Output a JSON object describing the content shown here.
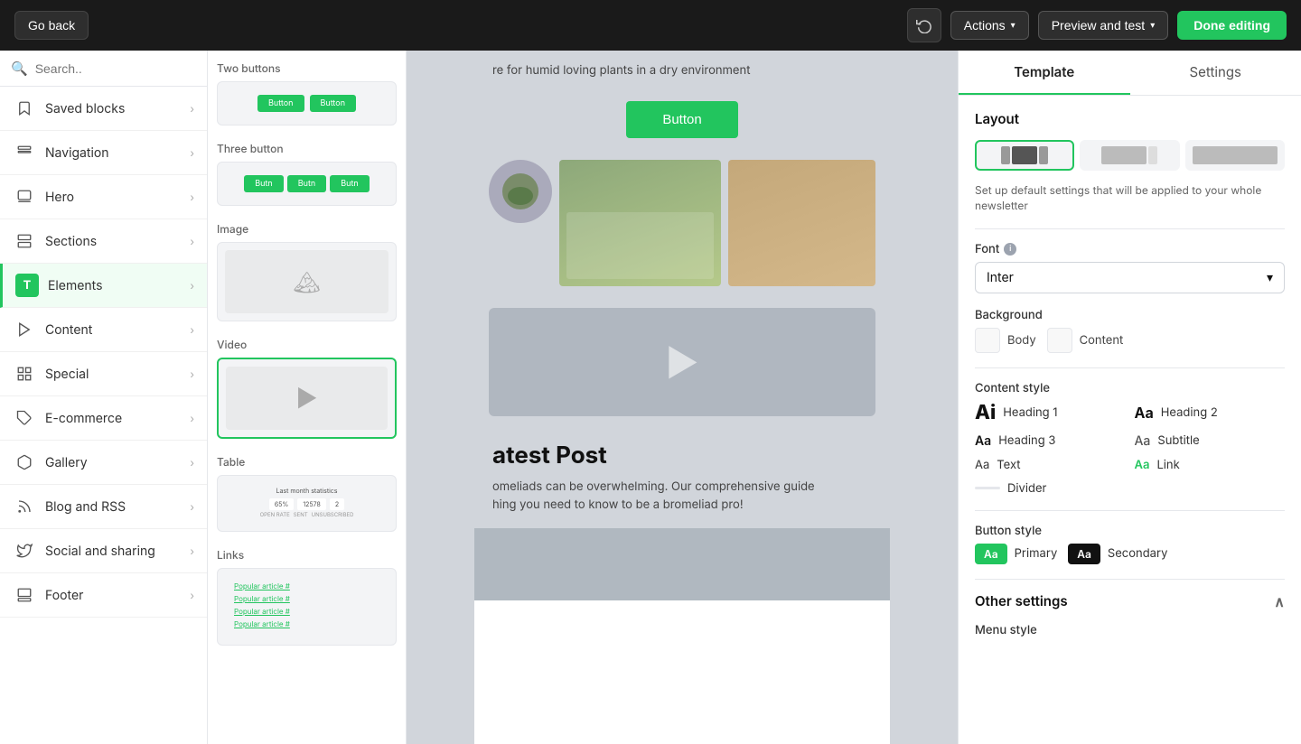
{
  "topbar": {
    "go_back_label": "Go back",
    "actions_label": "Actions",
    "preview_label": "Preview and test",
    "done_label": "Done editing"
  },
  "sidebar": {
    "search_placeholder": "Search..",
    "items": [
      {
        "id": "saved-blocks",
        "label": "Saved blocks",
        "icon": "bookmark"
      },
      {
        "id": "navigation",
        "label": "Navigation",
        "icon": "nav"
      },
      {
        "id": "hero",
        "label": "Hero",
        "icon": "hero"
      },
      {
        "id": "sections",
        "label": "Sections",
        "icon": "sections"
      },
      {
        "id": "elements",
        "label": "Elements",
        "icon": "elements",
        "active": true
      },
      {
        "id": "content",
        "label": "Content",
        "icon": "content"
      },
      {
        "id": "special",
        "label": "Special",
        "icon": "special"
      },
      {
        "id": "ecommerce",
        "label": "E-commerce",
        "icon": "ecommerce"
      },
      {
        "id": "gallery",
        "label": "Gallery",
        "icon": "gallery"
      },
      {
        "id": "blog-rss",
        "label": "Blog and RSS",
        "icon": "blog"
      },
      {
        "id": "social-sharing",
        "label": "Social and sharing",
        "icon": "social"
      },
      {
        "id": "footer",
        "label": "Footer",
        "icon": "footer"
      }
    ]
  },
  "blocks": {
    "items": [
      {
        "id": "two-buttons",
        "label": "Two buttons"
      },
      {
        "id": "three-button",
        "label": "Three button"
      },
      {
        "id": "image",
        "label": "Image"
      },
      {
        "id": "video",
        "label": "Video"
      },
      {
        "id": "table",
        "label": "Table"
      },
      {
        "id": "links",
        "label": "Links"
      }
    ],
    "table": {
      "title": "Last month statistics",
      "col1": "65%",
      "col1_label": "OPEN RATE",
      "col2": "12578",
      "col2_label": "SENT",
      "col3": "2",
      "col3_label": "UNSUBSCRIBED"
    },
    "links": [
      "Popular article #",
      "Popular article #",
      "Popular article #",
      "Popular article #"
    ]
  },
  "preview": {
    "text_banner": "re for humid loving plants in a dry environment",
    "button_label": "Button",
    "latest_post_title": "atest Post",
    "latest_post_partial_title": "atest Post",
    "latest_post_text": "omeliads can be overwhelming. Our comprehensive guide",
    "latest_post_text2": "hing you need to know to be a bromeliad pro!"
  },
  "right_panel": {
    "tab_template": "Template",
    "tab_settings": "Settings",
    "layout_title": "Layout",
    "layout_help": "Set up default settings that will be applied to your whole newsletter",
    "font_label": "Font",
    "font_value": "Inter",
    "background_label": "Background",
    "background_body": "Body",
    "background_content": "Content",
    "content_style_label": "Content style",
    "heading1": "Heading 1",
    "heading2": "Heading 2",
    "heading3": "Heading 3",
    "subtitle": "Subtitle",
    "text": "Text",
    "link": "Link",
    "divider": "Divider",
    "button_style_label": "Button style",
    "primary": "Primary",
    "secondary": "Secondary",
    "other_settings_label": "Other settings",
    "menu_style_label": "Menu style"
  }
}
